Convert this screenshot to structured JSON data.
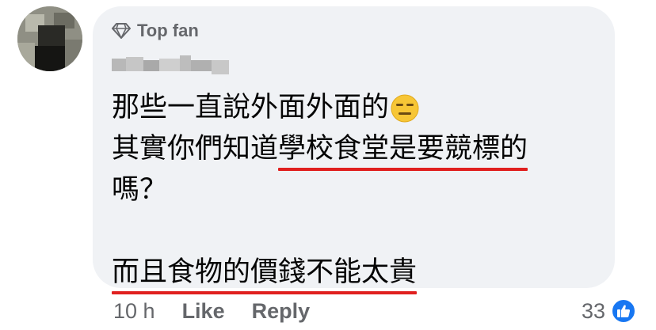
{
  "comment": {
    "badge_label": "Top fan",
    "author_name_obscured": "Realm Top",
    "lines": [
      {
        "text": "那些一直說外面外面的",
        "emoji": "expressionless-face-icon"
      },
      {
        "plain": "其實你們知道",
        "underlined": "學校食堂是要競標的"
      },
      {
        "text": "嗎？"
      },
      {
        "text": ""
      },
      {
        "underlined": "而且食物的價錢不能太貴"
      }
    ]
  },
  "actions": {
    "timestamp": "10 h",
    "like_label": "Like",
    "reply_label": "Reply"
  },
  "reactions": {
    "count": "33",
    "icon": "thumbs-up-icon"
  },
  "colors": {
    "bubble_bg": "#f0f2f5",
    "secondary_text": "#65676b",
    "underline_red": "#e0201f",
    "like_blue": "#1877f2"
  }
}
